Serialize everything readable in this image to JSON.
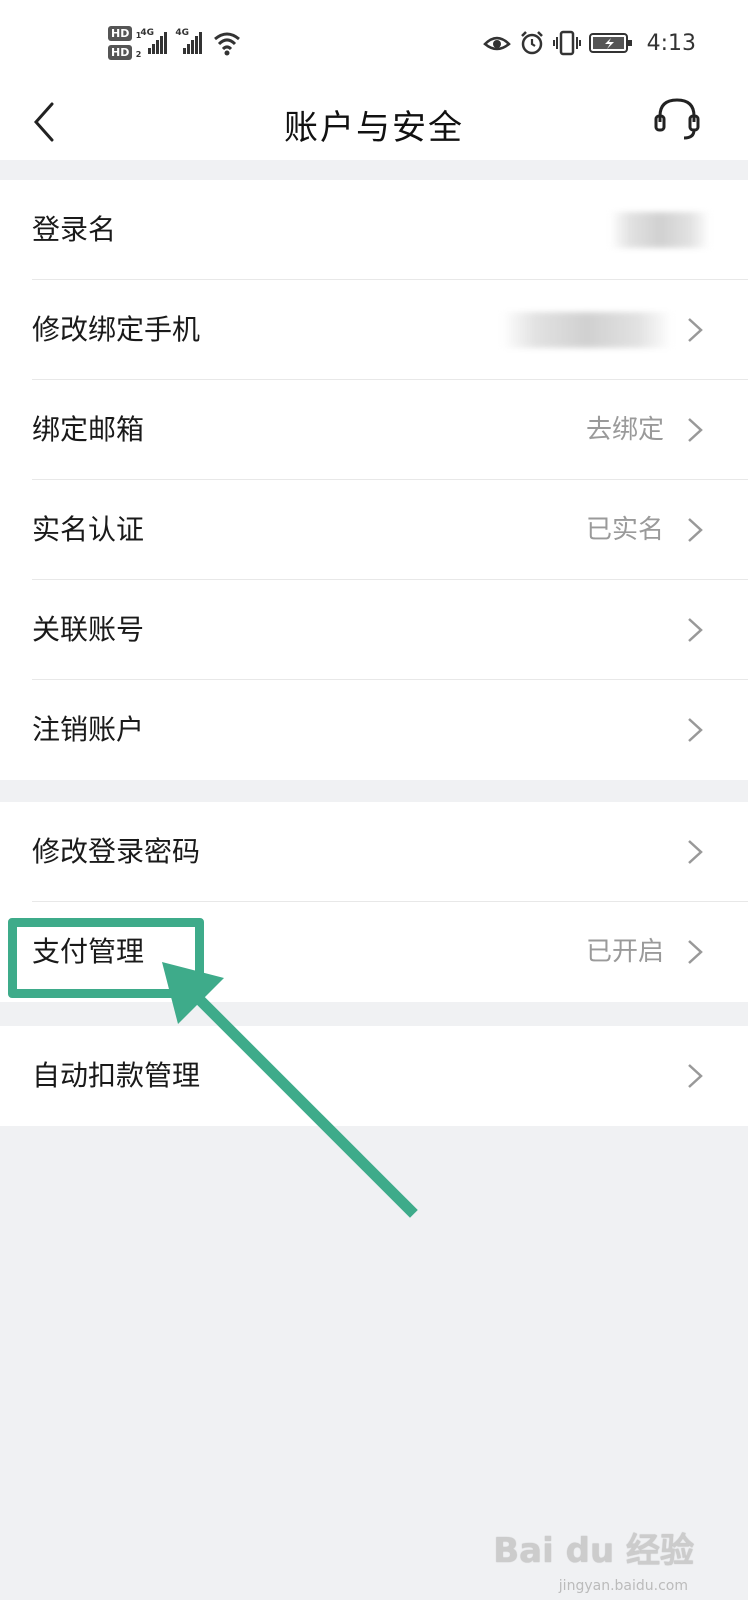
{
  "status_bar": {
    "hd1": "HD",
    "hd1_sub": "1",
    "hd2": "HD",
    "hd2_sub": "2",
    "net1": "4G",
    "net2": "4G",
    "time": "4:13",
    "icons": [
      "eye-icon",
      "alarm-icon",
      "vibrate-icon",
      "battery-icon"
    ]
  },
  "header": {
    "title": "账户与安全",
    "back_icon": "chevron-left-icon",
    "service_icon": "headset-icon"
  },
  "group1": [
    {
      "label": "登录名",
      "value": "",
      "chevron": false
    },
    {
      "label": "修改绑定手机",
      "value": "",
      "chevron": true
    },
    {
      "label": "绑定邮箱",
      "value": "去绑定",
      "chevron": true
    },
    {
      "label": "实名认证",
      "value": "已实名",
      "chevron": true
    },
    {
      "label": "关联账号",
      "value": "",
      "chevron": true
    },
    {
      "label": "注销账户",
      "value": "",
      "chevron": true
    }
  ],
  "group2": [
    {
      "label": "修改登录密码",
      "value": "",
      "chevron": true
    },
    {
      "label": "支付管理",
      "value": "已开启",
      "chevron": true
    }
  ],
  "group3": [
    {
      "label": "自动扣款管理",
      "value": "",
      "chevron": true
    }
  ],
  "watermark": {
    "text": "Bai du 经验",
    "sub": "jingyan.baidu.com"
  },
  "colors": {
    "highlight": "#3eab8a",
    "background": "#f0f1f3",
    "secondary_text": "#9a9a9a"
  }
}
